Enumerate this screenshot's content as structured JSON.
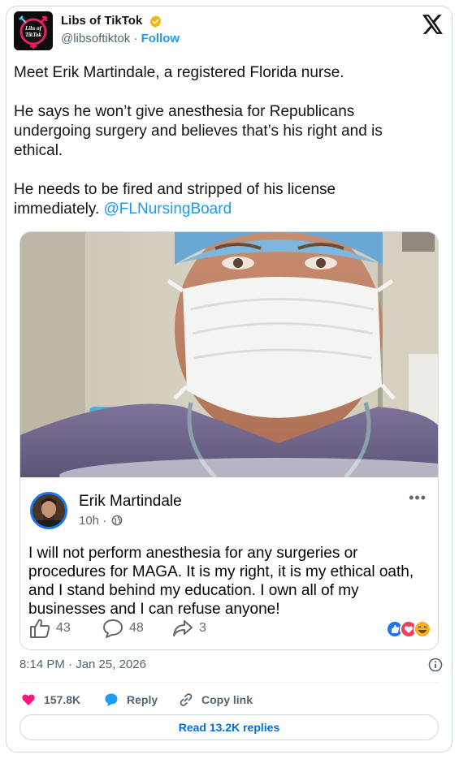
{
  "author": {
    "display_name": "Libs of TikTok",
    "handle": "@libsoftiktok",
    "separator": " · ",
    "follow_label": "Follow",
    "avatar_text_line1": "Libs of",
    "avatar_text_line2": "TikTok"
  },
  "tweet": {
    "paragraph1": "Meet Erik Martindale, a registered Florida nurse.",
    "paragraph2": "He says he won’t give anesthesia for Republicans undergoing surgery and believes that’s his right and is ethical.",
    "paragraph3_text": "He needs to be fired and stripped of his license immediately. ",
    "paragraph3_mention": "@FLNursingBoard"
  },
  "embedded_post": {
    "name": "Erik Martindale",
    "time": "10h",
    "time_separator": " · ",
    "body": "I will not perform anesthesia for any surgeries or procedures for MAGA. It is my right, it is my ethical oath, and I stand behind my education. I own all of my businesses and I can refuse anyone!",
    "more_label": "•••",
    "likes": "43",
    "comments": "48",
    "shares": "3"
  },
  "meta": {
    "timestamp": "8:14 PM · Jan 25, 2026"
  },
  "engagement": {
    "likes": "157.8K",
    "reply_label": "Reply",
    "copy_link_label": "Copy link"
  },
  "read_replies_label": "Read 13.2K replies",
  "colors": {
    "accent": "#1d9bf0",
    "like": "#f91880",
    "fb_blue": "#1877f2"
  }
}
